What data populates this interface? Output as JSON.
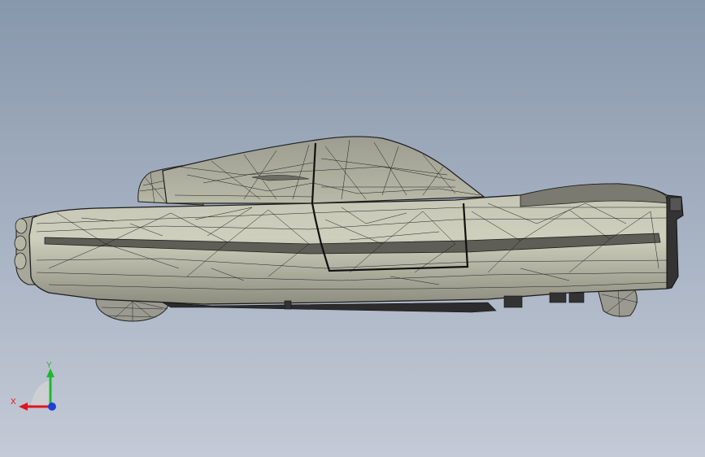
{
  "viewport": {
    "background_top": "#8797ab",
    "background_bottom": "#c4cad6"
  },
  "model": {
    "display_mode": "shaded-with-edges",
    "fill_color": "#c9c9b7",
    "edge_color": "#1e1e1e"
  },
  "triad": {
    "x_label": "X",
    "y_label": "Y",
    "x_color": "#e0141e",
    "y_color": "#1db82e",
    "z_color": "#1f3fd6"
  }
}
